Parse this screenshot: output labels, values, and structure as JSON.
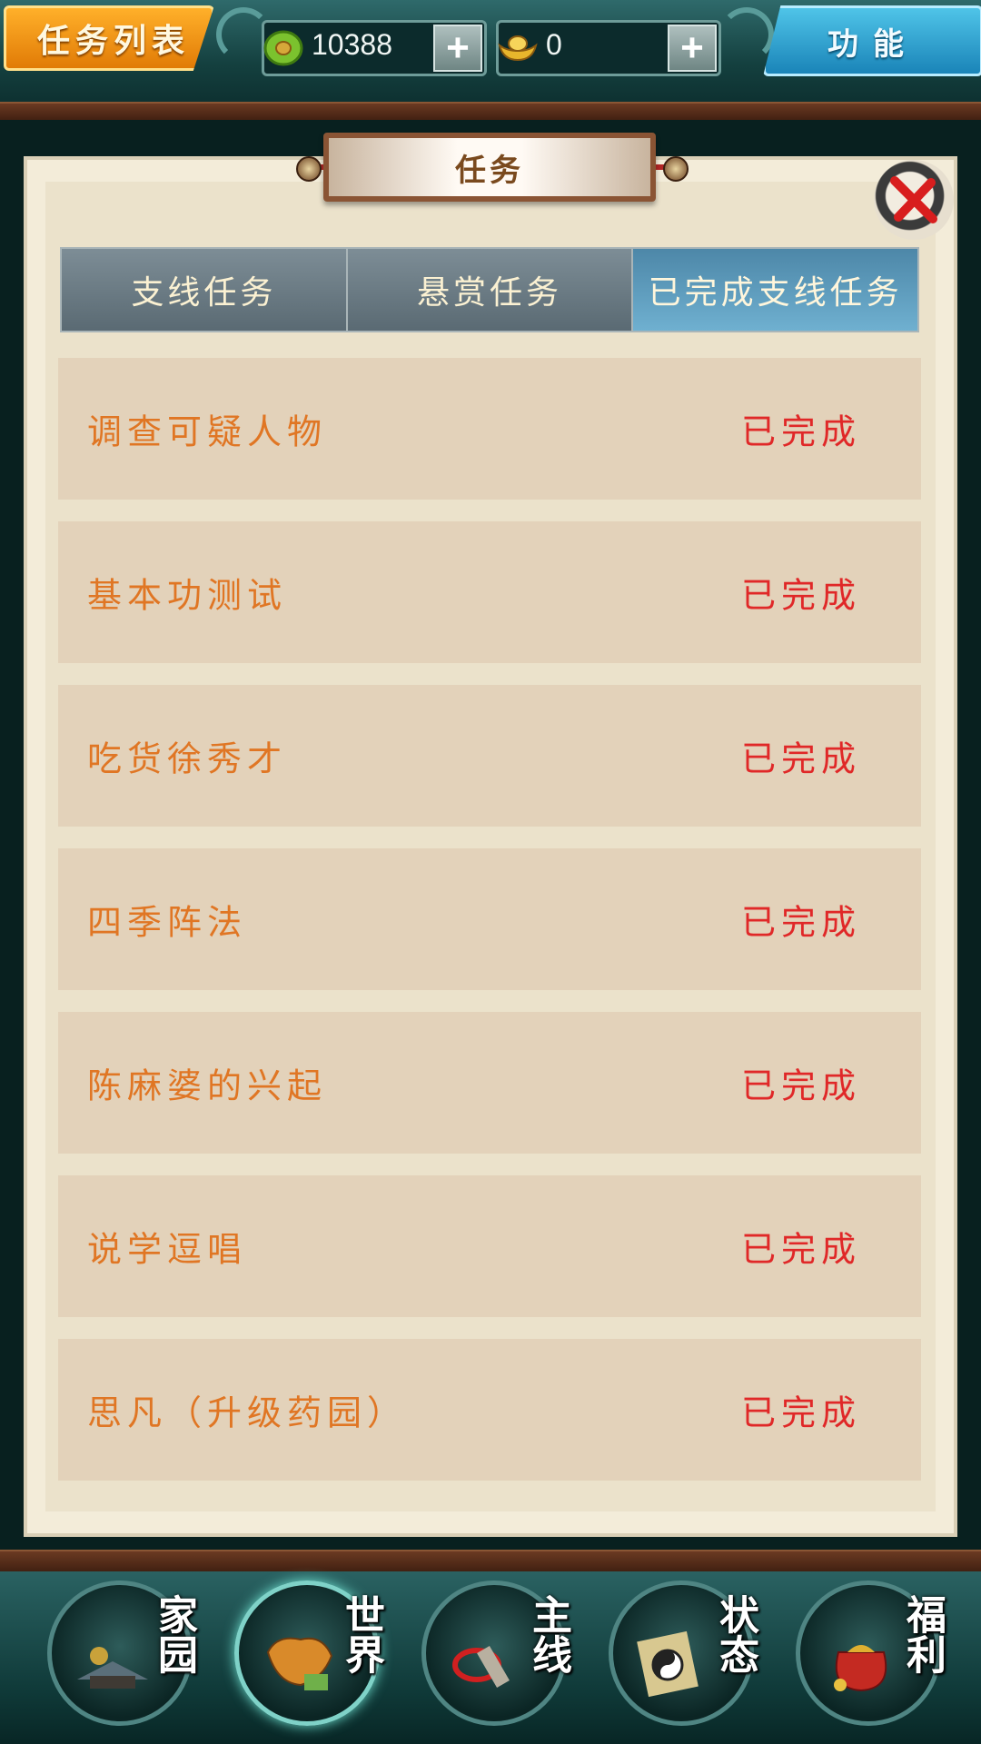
{
  "header": {
    "task_list_label": "任务列表",
    "function_label": "功能",
    "currency_jade": {
      "value": "10388",
      "icon": "jade-coin-icon",
      "plus": "+"
    },
    "currency_gold": {
      "value": "0",
      "icon": "gold-ingot-icon",
      "plus": "+"
    }
  },
  "panel": {
    "title": "任务",
    "tabs": [
      {
        "label": "支线任务",
        "active": false
      },
      {
        "label": "悬赏任务",
        "active": false
      },
      {
        "label": "已完成支线任务",
        "active": true
      }
    ],
    "tasks": [
      {
        "name": "调查可疑人物",
        "status": "已完成"
      },
      {
        "name": "基本功测试",
        "status": "已完成"
      },
      {
        "name": "吃货徐秀才",
        "status": "已完成"
      },
      {
        "name": "四季阵法",
        "status": "已完成"
      },
      {
        "name": "陈麻婆的兴起",
        "status": "已完成"
      },
      {
        "name": "说学逗唱",
        "status": "已完成"
      },
      {
        "name": "思凡（升级药园）",
        "status": "已完成"
      }
    ]
  },
  "bottom_nav": [
    {
      "label": "家园",
      "icon": "home-garden-icon",
      "active": false
    },
    {
      "label": "世界",
      "icon": "world-map-icon",
      "active": true
    },
    {
      "label": "主线",
      "icon": "main-quest-icon",
      "active": false
    },
    {
      "label": "状态",
      "icon": "status-bagua-icon",
      "active": false
    },
    {
      "label": "福利",
      "icon": "welfare-bag-icon",
      "active": false
    }
  ],
  "colors": {
    "task_name": "#e07624",
    "task_status": "#e02828",
    "tab_active": "#5a9cbf",
    "accent_orange": "#f39a14",
    "accent_blue": "#2aa0d4"
  }
}
